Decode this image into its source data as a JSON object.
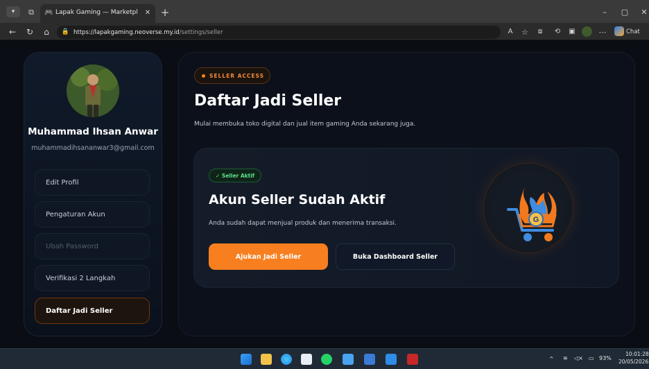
{
  "browser": {
    "tab_title": "Lapak Gaming — Marketplace Gar",
    "url_domain": "https://lapakgaming.neoverse.my.id",
    "url_path": "/settings/seller",
    "copilot_label": "Chat"
  },
  "sidebar": {
    "user_name": "Muhammad Ihsan Anwar",
    "user_email": "muhammadihsananwar3@gmail.com",
    "items": [
      {
        "label": "Edit Profil"
      },
      {
        "label": "Pengaturan Akun"
      },
      {
        "label": "Ubah Password"
      },
      {
        "label": "Verifikasi 2 Langkah"
      },
      {
        "label": "Daftar Jadi Seller"
      }
    ]
  },
  "main": {
    "badge": "SELLER ACCESS",
    "title": "Daftar Jadi Seller",
    "subtitle": "Mulai membuka toko digital dan jual item gaming Anda sekarang juga.",
    "card": {
      "status_pill": "✓ Seller Aktif",
      "heading": "Akun Seller Sudah Aktif",
      "description": "Anda sudah dapat menjual produk dan menerima transaksi.",
      "primary_button": "Ajukan Jadi Seller",
      "secondary_button": "Buka Dashboard Seller",
      "logo_letter": "G"
    }
  },
  "taskbar": {
    "battery": "93%",
    "time": "10:01:28",
    "date": "20/05/2026"
  },
  "colors": {
    "accent": "#f77f1f",
    "success": "#5ee08a"
  }
}
